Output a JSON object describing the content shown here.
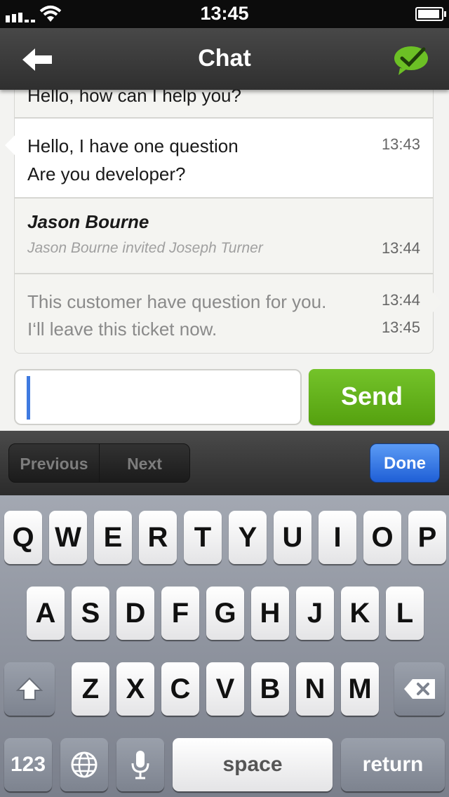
{
  "status_bar": {
    "time": "13:45"
  },
  "nav": {
    "title": "Chat",
    "back_icon": "back-arrow-icon",
    "action_icon": "chat-check-icon",
    "accent": "#6cc025"
  },
  "messages": [
    {
      "lines": [
        "Hello, how can I help you?"
      ],
      "times": []
    },
    {
      "lines": [
        "Hello, I have one question",
        "Are you developer?"
      ],
      "times": [
        "13:43"
      ]
    },
    {
      "author": "Jason Bourne",
      "lines": [
        "Jason Bourne invited Joseph Turner"
      ],
      "times": [
        "13:44"
      ]
    },
    {
      "lines": [
        "This customer have question for you.",
        "I‘ll leave this ticket now."
      ],
      "times": [
        "13:44",
        "13:45"
      ]
    }
  ],
  "composer": {
    "value": "",
    "send_label": "Send",
    "send_color": "#5aa812"
  },
  "accessory": {
    "previous_label": "Previous",
    "next_label": "Next",
    "done_label": "Done"
  },
  "keyboard": {
    "row1": [
      "Q",
      "W",
      "E",
      "R",
      "T",
      "Y",
      "U",
      "I",
      "O",
      "P"
    ],
    "row2": [
      "A",
      "S",
      "D",
      "F",
      "G",
      "H",
      "J",
      "K",
      "L"
    ],
    "row3": [
      "Z",
      "X",
      "C",
      "V",
      "B",
      "N",
      "M"
    ],
    "numbers_label": "123",
    "space_label": "space",
    "return_label": "return",
    "icons": [
      "shift-icon",
      "backspace-icon",
      "globe-icon",
      "microphone-icon"
    ]
  }
}
